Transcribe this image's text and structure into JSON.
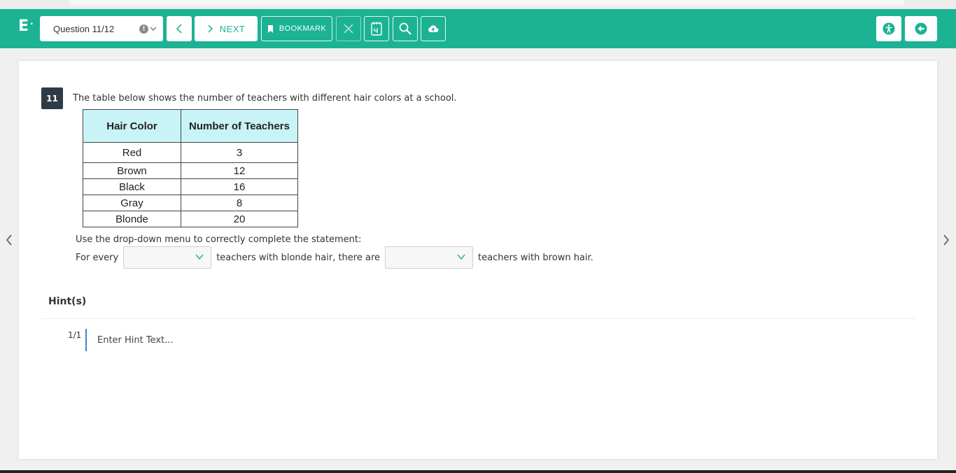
{
  "toolbar": {
    "logo": "E",
    "logo_dot": "·",
    "question_selector": "Question 11/12",
    "info_mark": "!",
    "next_label": "NEXT",
    "bookmark_label": "BOOKMARK"
  },
  "icons": [
    "info-icon",
    "chevron-down-icon",
    "chevron-left-icon",
    "chevron-right-icon",
    "bookmark-icon",
    "close-icon",
    "calculator-icon",
    "search-icon",
    "cloud-upload-icon",
    "accessibility-icon",
    "back-arrow-icon"
  ],
  "colors": {
    "toolbar": "#1bb394",
    "table_header": "#c8f4f7",
    "question_badge": "#2e3b46",
    "hint_bar": "#3a84d6"
  },
  "question": {
    "number": "11",
    "prompt": "The table below shows the number of teachers with different hair colors at a school.",
    "table": {
      "headers": [
        "Hair Color",
        "Number of Teachers"
      ],
      "rows": [
        [
          "Red",
          "3"
        ],
        [
          "Brown",
          "12"
        ],
        [
          "Black",
          "16"
        ],
        [
          "Gray",
          "8"
        ],
        [
          "Blonde",
          "20"
        ]
      ]
    },
    "instruction": "Use the drop-down menu to correctly complete the statement:",
    "sentence": {
      "part1": "For every",
      "part2": "teachers with blonde hair, there are",
      "part3": "teachers with brown hair."
    }
  },
  "hints": {
    "title": "Hint(s)",
    "count": "1/1",
    "placeholder": "Enter Hint Text..."
  }
}
